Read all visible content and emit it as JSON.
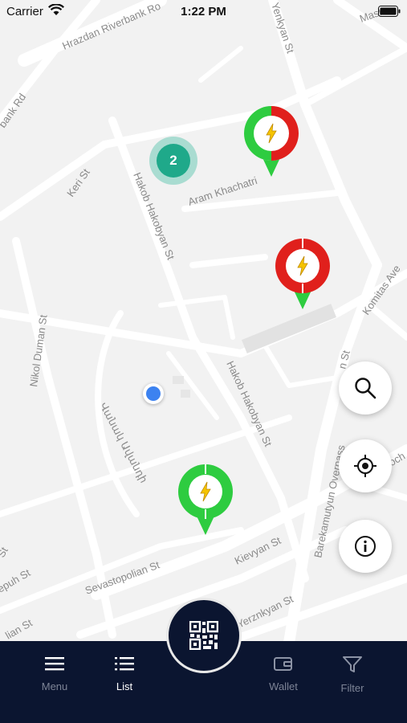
{
  "status_bar": {
    "carrier": "Carrier",
    "time": "1:22 PM"
  },
  "map": {
    "streets": [
      "Hrazdan Riverbank Ro",
      "Mash",
      "Yenkyan St",
      "bank Rd",
      "Keri St",
      "Hakob Hakobyan St",
      "Aram Khachatri",
      "Komitas Ave",
      "Nikol Duman St",
      "Hakob Hakobyan St",
      "Barekamutyun Overpass",
      "Kievyan St",
      "Sevastopolian St",
      "Yerznkyan St",
      "epuh St",
      "lian St",
      "ioch",
      "Վանակ Ավանդի",
      "St",
      "n St"
    ],
    "cluster_count": "2"
  },
  "buttons": {
    "search": "search-icon",
    "locate": "locate-icon",
    "info": "info-icon"
  },
  "tabbar": {
    "items": [
      {
        "label": "Menu",
        "icon": "menu-icon"
      },
      {
        "label": "List",
        "icon": "list-icon"
      },
      {
        "label": "Wallet",
        "icon": "wallet-icon"
      },
      {
        "label": "Filter",
        "icon": "filter-icon"
      }
    ],
    "center": "qr-code-icon"
  },
  "colors": {
    "available": "#2ecc40",
    "busy": "#e0201c",
    "tabbar": "#0b1530",
    "cluster": "#1fa98a"
  }
}
